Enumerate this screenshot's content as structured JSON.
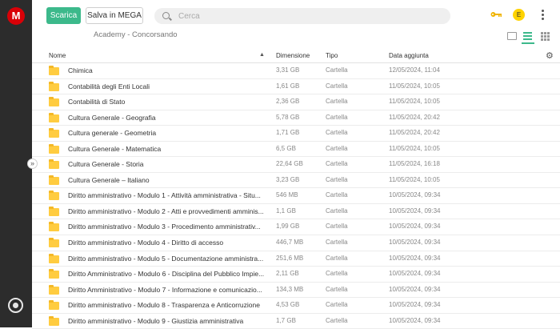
{
  "sidebar": {
    "logo_letter": "M"
  },
  "toolbar": {
    "download_label": "Scarica",
    "save_label": "Salva in MEGA",
    "search_placeholder": "Cerca",
    "avatar_letter": "E"
  },
  "breadcrumb": "Academy - Concorsando",
  "columns": {
    "name": "Nome",
    "size": "Dimensione",
    "type": "Tipo",
    "date": "Data aggiunta"
  },
  "rows": [
    {
      "name": "Chimica",
      "size": "3,31 GB",
      "type": "Cartella",
      "date": "12/05/2024, 11:04"
    },
    {
      "name": "Contabilità degli Enti Locali",
      "size": "1,61 GB",
      "type": "Cartella",
      "date": "11/05/2024, 10:05"
    },
    {
      "name": "Contabilità di Stato",
      "size": "2,36 GB",
      "type": "Cartella",
      "date": "11/05/2024, 10:05"
    },
    {
      "name": "Cultura Generale - Geografia",
      "size": "5,78 GB",
      "type": "Cartella",
      "date": "11/05/2024, 20:42"
    },
    {
      "name": "Cultura generale - Geometria",
      "size": "1,71 GB",
      "type": "Cartella",
      "date": "11/05/2024, 20:42"
    },
    {
      "name": "Cultura Generale - Matematica",
      "size": "6,5 GB",
      "type": "Cartella",
      "date": "11/05/2024, 10:05"
    },
    {
      "name": "Cultura Generale - Storia",
      "size": "22,64 GB",
      "type": "Cartella",
      "date": "11/05/2024, 16:18"
    },
    {
      "name": "Cultura Generale – Italiano",
      "size": "3,23 GB",
      "type": "Cartella",
      "date": "11/05/2024, 10:05"
    },
    {
      "name": "Diritto amministrativo - Modulo 1 - Attività amministrativa - Situ...",
      "size": "546 MB",
      "type": "Cartella",
      "date": "10/05/2024, 09:34"
    },
    {
      "name": "Diritto amministrativo - Modulo 2 - Atti e provvedimenti amminis...",
      "size": "1,1 GB",
      "type": "Cartella",
      "date": "10/05/2024, 09:34"
    },
    {
      "name": "Diritto amministrativo - Modulo 3 - Procedimento amministrativ...",
      "size": "1,99 GB",
      "type": "Cartella",
      "date": "10/05/2024, 09:34"
    },
    {
      "name": "Diritto amministrativo - Modulo 4 - Diritto di accesso",
      "size": "446,7 MB",
      "type": "Cartella",
      "date": "10/05/2024, 09:34"
    },
    {
      "name": "Diritto amministrativo - Modulo 5 - Documentazione amministra...",
      "size": "251,6 MB",
      "type": "Cartella",
      "date": "10/05/2024, 09:34"
    },
    {
      "name": "Diritto Amministrativo - Modulo 6 - Disciplina del Pubblico Impie...",
      "size": "2,11 GB",
      "type": "Cartella",
      "date": "10/05/2024, 09:34"
    },
    {
      "name": "Diritto Amministrativo - Modulo 7 - Informazione e comunicazio...",
      "size": "134,3 MB",
      "type": "Cartella",
      "date": "10/05/2024, 09:34"
    },
    {
      "name": "Diritto amministrativo - Modulo 8 - Trasparenza e Anticorruzione",
      "size": "4,53 GB",
      "type": "Cartella",
      "date": "10/05/2024, 09:34"
    },
    {
      "name": "Diritto amministrativo - Modulo 9 - Giustizia amministrativa",
      "size": "1,7 GB",
      "type": "Cartella",
      "date": "10/05/2024, 09:34"
    }
  ]
}
